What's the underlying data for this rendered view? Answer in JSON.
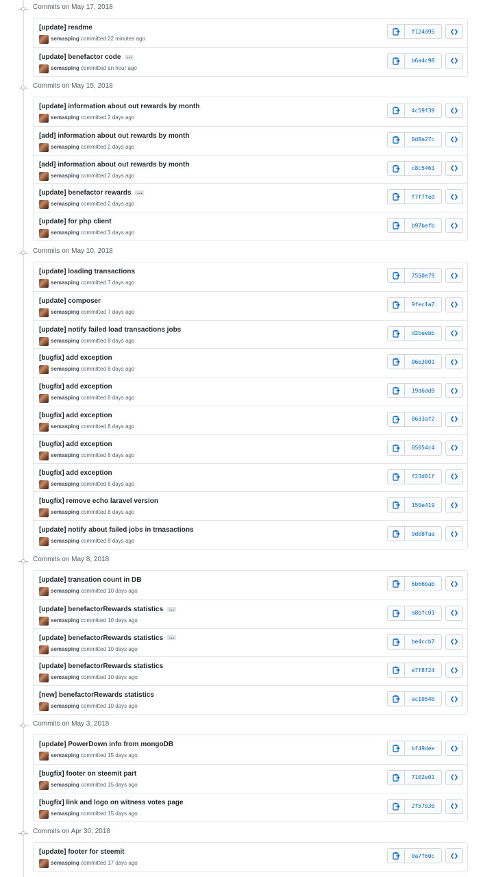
{
  "groups": [
    {
      "title": "Commits on May 17, 2018",
      "commits": [
        {
          "message": "[update] readme",
          "ellipsis": false,
          "author": "semasping",
          "time": "committed 22 minutes ago",
          "sha": "f124d95"
        },
        {
          "message": "[update] benefactor code",
          "ellipsis": true,
          "author": "semasping",
          "time": "committed an hour ago",
          "sha": "b6a4c98"
        }
      ]
    },
    {
      "title": "Commits on May 15, 2018",
      "commits": [
        {
          "message": "[update] information about out rewards by month",
          "ellipsis": false,
          "author": "semasping",
          "time": "committed 2 days ago",
          "sha": "4c59f39"
        },
        {
          "message": "[add] information about out rewards by month",
          "ellipsis": false,
          "author": "semasping",
          "time": "committed 2 days ago",
          "sha": "0d8e27c"
        },
        {
          "message": "[add] information about out rewards by month",
          "ellipsis": false,
          "author": "semasping",
          "time": "committed 2 days ago",
          "sha": "c8c5461"
        },
        {
          "message": "[update] benefactor rewards",
          "ellipsis": true,
          "author": "semasping",
          "time": "committed 2 days ago",
          "sha": "f7f7fed"
        },
        {
          "message": "[update] for php client",
          "ellipsis": false,
          "author": "semasping",
          "time": "committed 3 days ago",
          "sha": "b97befb"
        }
      ]
    },
    {
      "title": "Commits on May 10, 2018",
      "commits": [
        {
          "message": "[update] loading transactions",
          "ellipsis": false,
          "author": "semasping",
          "time": "committed 7 days ago",
          "sha": "7550e79"
        },
        {
          "message": "[update] composer",
          "ellipsis": false,
          "author": "semasping",
          "time": "committed 7 days ago",
          "sha": "9fec1a7"
        },
        {
          "message": "[update] notify failed load transactions jobs",
          "ellipsis": false,
          "author": "semasping",
          "time": "committed 8 days ago",
          "sha": "d2beebb"
        },
        {
          "message": "[bugfix] add exception",
          "ellipsis": false,
          "author": "semasping",
          "time": "committed 8 days ago",
          "sha": "06e3001"
        },
        {
          "message": "[bugfix] add exception",
          "ellipsis": false,
          "author": "semasping",
          "time": "committed 8 days ago",
          "sha": "19d6dd9"
        },
        {
          "message": "[bugfix] add exception",
          "ellipsis": false,
          "author": "semasping",
          "time": "committed 8 days ago",
          "sha": "8633af2"
        },
        {
          "message": "[bugfix] add exception",
          "ellipsis": false,
          "author": "semasping",
          "time": "committed 8 days ago",
          "sha": "05054c4"
        },
        {
          "message": "[bugfix] add exception",
          "ellipsis": false,
          "author": "semasping",
          "time": "committed 8 days ago",
          "sha": "f23d81f"
        },
        {
          "message": "[bugfix] remove echo laravel version",
          "ellipsis": false,
          "author": "semasping",
          "time": "committed 8 days ago",
          "sha": "150e419"
        },
        {
          "message": "[update] notify about failed jobs in trnasactions",
          "ellipsis": false,
          "author": "semasping",
          "time": "committed 8 days ago",
          "sha": "9d08faa"
        }
      ]
    },
    {
      "title": "Commits on May 8, 2018",
      "commits": [
        {
          "message": "[update] transation count in DB",
          "ellipsis": false,
          "author": "semasping",
          "time": "committed 10 days ago",
          "sha": "6b66bab"
        },
        {
          "message": "[update] benefactorRewards statistics",
          "ellipsis": true,
          "author": "semasping",
          "time": "committed 10 days ago",
          "sha": "a8bfc01"
        },
        {
          "message": "[update] benefactorRewards statistics",
          "ellipsis": true,
          "author": "semasping",
          "time": "committed 10 days ago",
          "sha": "be4ccb7"
        },
        {
          "message": "[update] benefactorRewards statistics",
          "ellipsis": false,
          "author": "semasping",
          "time": "committed 10 days ago",
          "sha": "e7f8f24"
        },
        {
          "message": "[new] benefactorRewards statistics",
          "ellipsis": false,
          "author": "semasping",
          "time": "committed 10 days ago",
          "sha": "ac10540"
        }
      ]
    },
    {
      "title": "Commits on May 3, 2018",
      "commits": [
        {
          "message": "[update] PowerDown info from mongoDB",
          "ellipsis": false,
          "author": "semasping",
          "time": "committed 15 days ago",
          "sha": "bf49dee"
        },
        {
          "message": "[bugfix] footer on steemit part",
          "ellipsis": false,
          "author": "semasping",
          "time": "committed 15 days ago",
          "sha": "7102e01"
        },
        {
          "message": "[bugfix] link and logo on witness votes page",
          "ellipsis": false,
          "author": "semasping",
          "time": "committed 15 days ago",
          "sha": "2f57b30"
        }
      ]
    },
    {
      "title": "Commits on Apr 30, 2018",
      "commits": [
        {
          "message": "[update] footer for steemit",
          "ellipsis": false,
          "author": "semasping",
          "time": "committed 17 days ago",
          "sha": "0a7f60c"
        }
      ]
    }
  ],
  "icons": {
    "copy": "clipboard-icon",
    "browse": "code-icon",
    "node": "commit-node-icon"
  },
  "colors": {
    "link": "#0366d6",
    "border": "#e1e4e8",
    "muted": "#586069",
    "text": "#24292e"
  }
}
